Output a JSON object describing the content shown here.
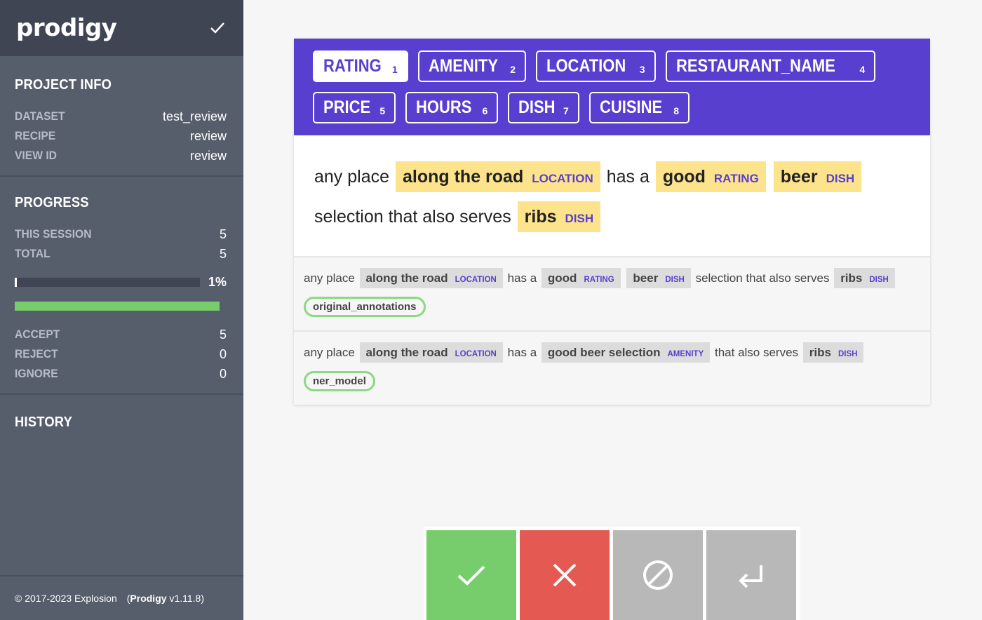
{
  "app": {
    "logo": "prodigy"
  },
  "project_info": {
    "title": "PROJECT INFO",
    "rows": [
      {
        "key": "DATASET",
        "value": "test_review"
      },
      {
        "key": "RECIPE",
        "value": "review"
      },
      {
        "key": "VIEW ID",
        "value": "review"
      }
    ]
  },
  "progress": {
    "title": "PROGRESS",
    "session_key": "THIS SESSION",
    "session_value": "5",
    "total_key": "TOTAL",
    "total_value": "5",
    "percent": "1%",
    "fraction": 0.01,
    "counts": [
      {
        "key": "ACCEPT",
        "value": "5"
      },
      {
        "key": "REJECT",
        "value": "0"
      },
      {
        "key": "IGNORE",
        "value": "0"
      }
    ]
  },
  "history": {
    "title": "HISTORY"
  },
  "footer": {
    "copyright": "© 2017-2023 Explosion",
    "product": "Prodigy",
    "version": "v1.11.8"
  },
  "labels": [
    {
      "text": "RATING",
      "key": "1"
    },
    {
      "text": "AMENITY",
      "key": "2"
    },
    {
      "text": "LOCATION",
      "key": "3"
    },
    {
      "text": "RESTAURANT_NAME",
      "key": "4"
    },
    {
      "text": "PRICE",
      "key": "5"
    },
    {
      "text": "HOURS",
      "key": "6"
    },
    {
      "text": "DISH",
      "key": "7"
    },
    {
      "text": "CUISINE",
      "key": "8"
    }
  ],
  "main": {
    "t1": "any place",
    "e1": "along the road",
    "l1": "LOCATION",
    "t2": "has a",
    "e2": "good",
    "l2": "RATING",
    "e3": "beer",
    "l3": "DISH",
    "t3": "selection that also serves",
    "e4": "ribs",
    "l4": "DISH"
  },
  "version1": {
    "t1": "any place",
    "e1": "along the road",
    "l1": "LOCATION",
    "t2": "has a",
    "e2": "good",
    "l2": "RATING",
    "e3": "beer",
    "l3": "DISH",
    "t3": "selection that also serves",
    "e4": "ribs",
    "l4": "DISH",
    "source": "original_annotations"
  },
  "version2": {
    "t1": "any place",
    "e1": "along the road",
    "l1": "LOCATION",
    "t2": "has a",
    "e2": "good beer selection",
    "l2": "AMENITY",
    "t3": "that also serves",
    "e3": "ribs",
    "l3": "DISH",
    "source": "ner_model"
  },
  "colors": {
    "accent": "#583fcf",
    "accept": "#77cd6b",
    "reject": "#e45a52",
    "ignore": "#b8b8b8",
    "highlight": "#fde48c"
  }
}
